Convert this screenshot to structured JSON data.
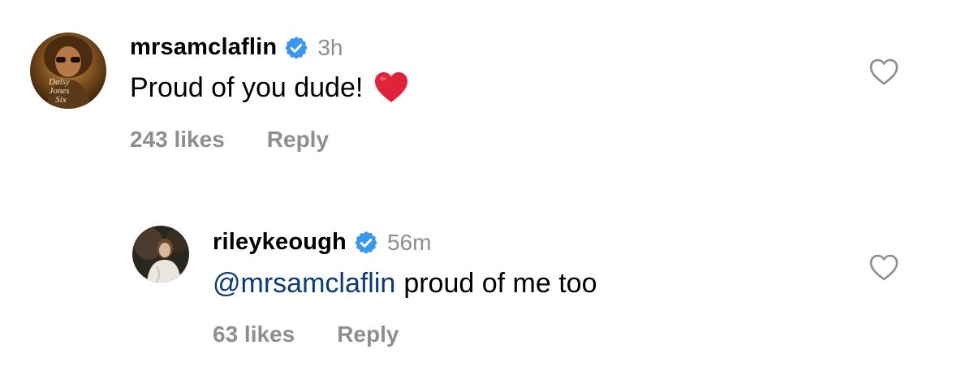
{
  "comments": [
    {
      "username": "mrsamclaflin",
      "time": "3h",
      "text": "Proud of you dude!",
      "likes": "243 likes",
      "reply": "Reply",
      "avatar_text": [
        "Daisy",
        "Jones",
        "Six"
      ],
      "emoji": "red-heart"
    },
    {
      "username": "rileykeough",
      "time": "56m",
      "mention": "@mrsamclaflin",
      "text": "proud of me too",
      "likes": "63 likes",
      "reply": "Reply"
    }
  ],
  "colors": {
    "verified": "#3897f0",
    "muted": "#8e8e8e",
    "mention": "#0a3a78",
    "heart": "#e0233b"
  },
  "icons": {
    "verified": "verified-badge-icon",
    "like": "heart-outline-icon"
  }
}
